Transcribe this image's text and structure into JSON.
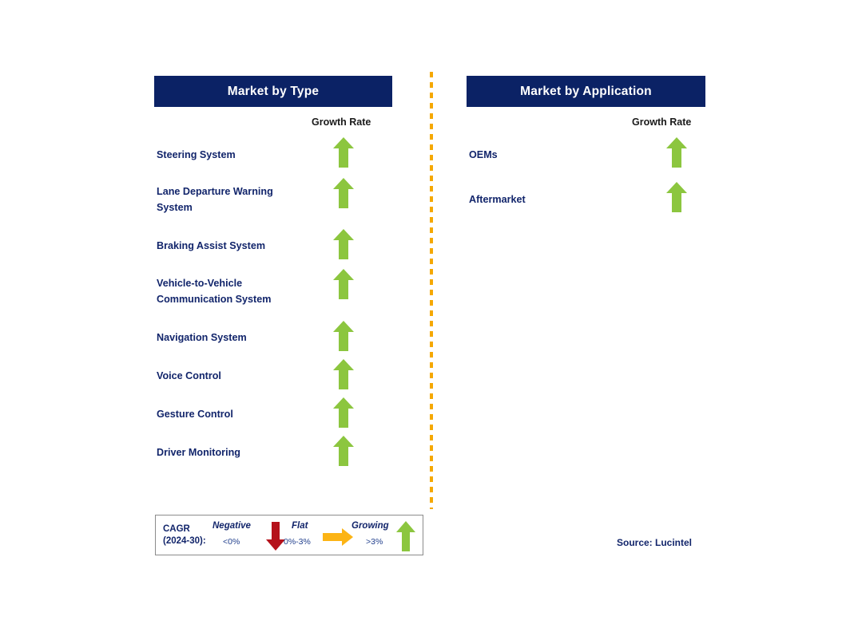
{
  "panels": [
    {
      "id": "market-by-type",
      "title": "Market by Type",
      "growth_caption": "Growth Rate",
      "segments": [
        {
          "label": "Steering System",
          "growth": "Growing",
          "icon": "arrow-up-icon"
        },
        {
          "label": "Lane Departure Warning\nSystem",
          "growth": "Growing",
          "icon": "arrow-up-icon"
        },
        {
          "label": "Braking Assist System",
          "growth": "Growing",
          "icon": "arrow-up-icon"
        },
        {
          "label": "Vehicle-to-Vehicle\nCommunication System",
          "growth": "Growing",
          "icon": "arrow-up-icon"
        },
        {
          "label": "Navigation System",
          "growth": "Growing",
          "icon": "arrow-up-icon"
        },
        {
          "label": "Voice Control",
          "growth": "Growing",
          "icon": "arrow-up-icon"
        },
        {
          "label": "Gesture Control",
          "growth": "Growing",
          "icon": "arrow-up-icon"
        },
        {
          "label": "Driver Monitoring",
          "growth": "Growing",
          "icon": "arrow-up-icon"
        }
      ]
    },
    {
      "id": "market-by-application",
      "title": "Market by Application",
      "growth_caption": "Growth Rate",
      "segments": [
        {
          "label": "OEMs",
          "growth": "Growing",
          "icon": "arrow-up-icon"
        },
        {
          "label": "Aftermarket",
          "growth": "Growing",
          "icon": "arrow-up-icon"
        }
      ]
    }
  ],
  "legend": {
    "title_line1": "CAGR",
    "title_line2": "(2024-30):",
    "title": "CAGR\n(2024-30):",
    "items": [
      {
        "term": "Negative",
        "range": "<0%",
        "icon": "arrow-down-icon",
        "color": "#b5121b"
      },
      {
        "term": "Flat",
        "range": "0%-3%",
        "icon": "arrow-right-icon",
        "color": "#fcb415"
      },
      {
        "term": "Growing",
        "range": ">3%",
        "icon": "arrow-up-icon",
        "color": "#8cc63f"
      }
    ]
  },
  "source": "Source: Lucintel",
  "colors": {
    "header_navy": "#0b2265",
    "label_navy": "#12256b",
    "growing_green": "#8cc63f",
    "negative_red": "#b5121b",
    "flat_amber": "#fcb415",
    "divider_orange": "#f5a800",
    "legend_border": "#8c8c8c",
    "background": "#ffffff"
  },
  "chart_data": {
    "type": "table",
    "title": "Market Segment Growth Rate Outlook",
    "columns": [
      "Segment",
      "Growth Rate"
    ],
    "panels": [
      {
        "name": "Market by Type",
        "rows": [
          [
            "Steering System",
            "Growing (>3%)"
          ],
          [
            "Lane Departure Warning System",
            "Growing (>3%)"
          ],
          [
            "Braking Assist System",
            "Growing (>3%)"
          ],
          [
            "Vehicle-to-Vehicle Communication System",
            "Growing (>3%)"
          ],
          [
            "Navigation System",
            "Growing (>3%)"
          ],
          [
            "Voice Control",
            "Growing (>3%)"
          ],
          [
            "Gesture Control",
            "Growing (>3%)"
          ],
          [
            "Driver Monitoring",
            "Growing (>3%)"
          ]
        ]
      },
      {
        "name": "Market by Application",
        "rows": [
          [
            "OEMs",
            "Growing (>3%)"
          ],
          [
            "Aftermarket",
            "Growing (>3%)"
          ]
        ]
      }
    ],
    "legend": {
      "label": "CAGR (2024-30):",
      "categories": [
        {
          "name": "Negative",
          "range": "<0%",
          "symbol": "down arrow",
          "color": "#b5121b"
        },
        {
          "name": "Flat",
          "range": "0%-3%",
          "symbol": "right arrow",
          "color": "#fcb415"
        },
        {
          "name": "Growing",
          "range": ">3%",
          "symbol": "up arrow",
          "color": "#8cc63f"
        }
      ]
    },
    "source": "Source: Lucintel"
  }
}
